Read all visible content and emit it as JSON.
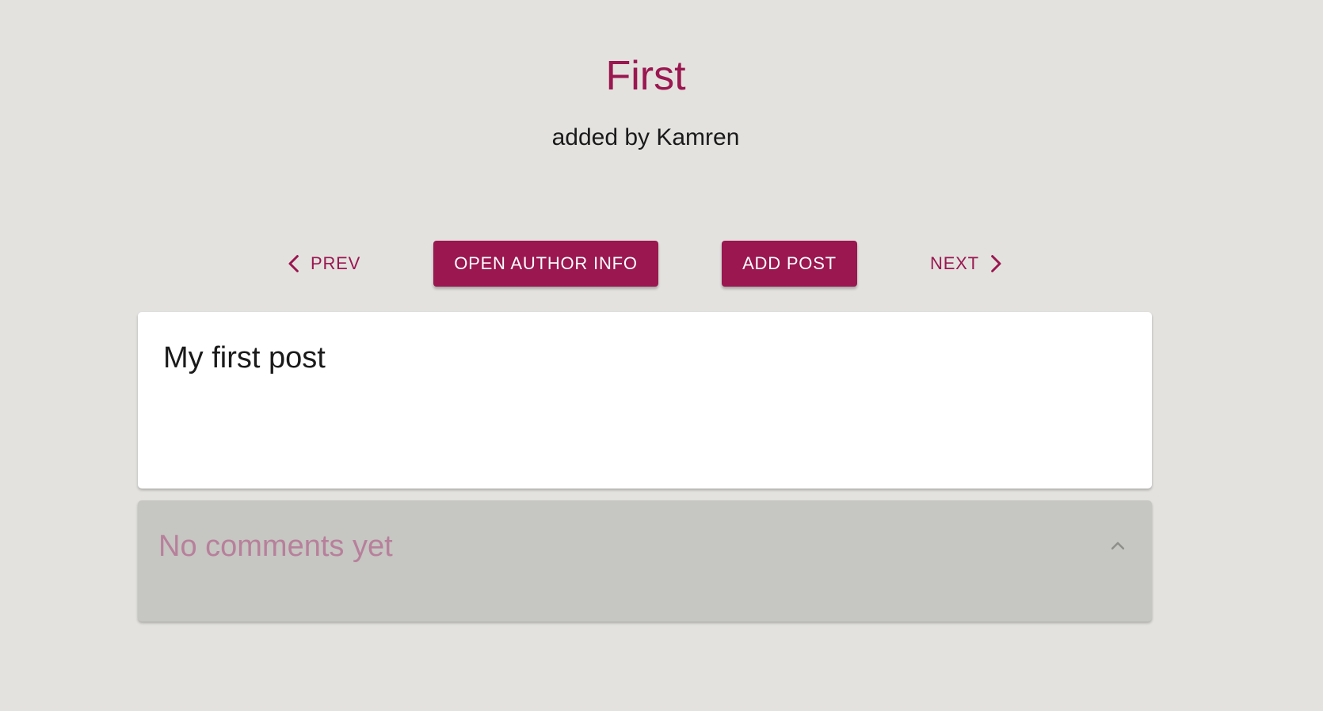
{
  "post": {
    "title": "First",
    "author_line": "added by Kamren",
    "body": "My first post"
  },
  "nav": {
    "prev_label": "PREV",
    "open_author_label": "OPEN AUTHOR INFO",
    "add_post_label": "ADD POST",
    "next_label": "NEXT"
  },
  "comments": {
    "summary": "No comments yet"
  },
  "icons": {
    "prev": "chevron-left-icon",
    "next": "chevron-right-icon",
    "expand": "chevron-up-icon"
  },
  "colors": {
    "accent": "#9a1750",
    "background": "#e3e2df",
    "comments_panel": "#c6c6c2",
    "comments_text": "#b7809b"
  }
}
